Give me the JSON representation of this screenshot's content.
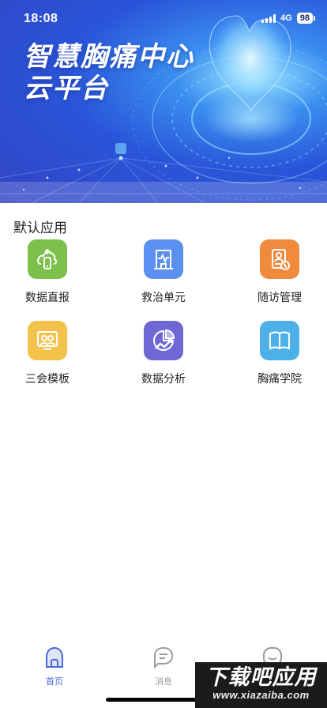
{
  "status_bar": {
    "time": "18:08",
    "network": "4G",
    "battery": "98"
  },
  "hero": {
    "title_line1": "智慧胸痛中心",
    "title_line2": "云平台"
  },
  "section": {
    "title": "默认应用"
  },
  "apps": [
    {
      "label": "数据直报",
      "color": "#7cc04b",
      "icon": "cloud-phone-icon"
    },
    {
      "label": "救治单元",
      "color": "#5b8ff0",
      "icon": "hospital-heartbeat-icon"
    },
    {
      "label": "随访管理",
      "color": "#f08a3c",
      "icon": "clipboard-phone-icon"
    },
    {
      "label": "三会模板",
      "color": "#f2c24a",
      "icon": "meeting-board-icon"
    },
    {
      "label": "数据分析",
      "color": "#6f67d4",
      "icon": "chart-trend-icon"
    },
    {
      "label": "胸痛学院",
      "color": "#4db0e8",
      "icon": "open-book-icon"
    }
  ],
  "tabbar": {
    "home_label": "首页",
    "messages_label": "消息",
    "active_color": "#4a66dc",
    "inactive_color": "#9a9a9a"
  },
  "watermark": {
    "line1": "下载吧应用",
    "line2": "www.xiazaiba.com"
  }
}
